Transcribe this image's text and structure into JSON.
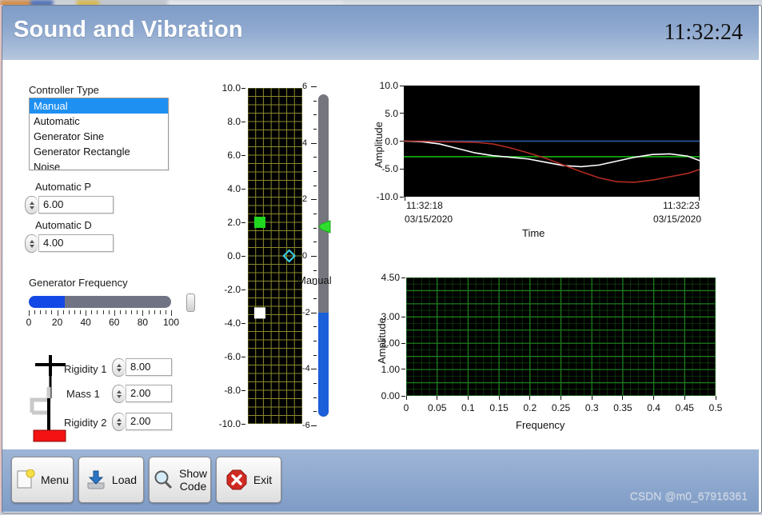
{
  "window": {
    "title": "Sound and Vibration",
    "clock": "11:32:24"
  },
  "watermark": "CSDN @m0_67916361",
  "controller": {
    "label": "Controller Type",
    "options": [
      "Manual",
      "Automatic",
      "Generator Sine",
      "Generator Rectangle",
      "Noise"
    ],
    "selected": "Manual"
  },
  "numerics": [
    {
      "label": "Automatic P",
      "value": "6.00"
    },
    {
      "label": "Automatic D",
      "value": "4.00"
    }
  ],
  "frequency": {
    "label": "Generator Frequency",
    "value": 25,
    "min": 0,
    "max": 100,
    "ticks": [
      "0",
      "20",
      "40",
      "60",
      "80",
      "100"
    ]
  },
  "mechanics": [
    {
      "label": "Rigidity 1",
      "value": "8.00"
    },
    {
      "label": "Mass 1",
      "value": "2.00"
    },
    {
      "label": "Rigidity 2",
      "value": "2.00"
    }
  ],
  "manual_slider": {
    "label": "Manual",
    "value": -2.6,
    "min": -6,
    "max": 6,
    "ticks": [
      "6",
      "4",
      "2",
      "0",
      "-2",
      "-4",
      "-6"
    ]
  },
  "colors": {
    "accent": "#1e90f2",
    "header_blue": "#8fa9cf",
    "plot_bg": "#000000",
    "grid_olive": "#8a8a2e",
    "grid_green": "#1d7d1d",
    "marker_green": "#1fd81f",
    "marker_white": "#ffffff",
    "marker_cyan": "#3fd0e8",
    "trace_red": "#b02b22",
    "trace_blue": "#2d5fa8",
    "trace_green": "#12b512",
    "trace_white": "#ffffff",
    "slider_blue": "#1448e6",
    "exit_red": "#c0392b"
  },
  "buttons": [
    {
      "label": "Menu",
      "icon": "page-icon"
    },
    {
      "label": "Load",
      "icon": "load-disk-icon"
    },
    {
      "label": "Show Code",
      "label_l1": "Show",
      "label_l2": "Code",
      "icon": "magnifier-icon"
    },
    {
      "label": "Exit",
      "icon": "stop-x-icon"
    }
  ],
  "chart_data": [
    {
      "id": "position-strip",
      "type": "scatter",
      "title": "",
      "xlabel": "",
      "ylabel": "",
      "ylim": [
        -10.0,
        10.0
      ],
      "yticks": [
        "10.0",
        "8.0",
        "6.0",
        "4.0",
        "2.0",
        "0.0",
        "-2.0",
        "-4.0",
        "-6.0",
        "-8.0",
        "-10.0"
      ],
      "grid": true,
      "grid_color": "#8a8a2e",
      "points": [
        {
          "name": "mass-marker-green",
          "x": 0.22,
          "y": 2.0,
          "color": "#1fd81f",
          "shape": "square"
        },
        {
          "name": "mass-marker-white",
          "x": 0.22,
          "y": -3.4,
          "color": "#ffffff",
          "shape": "square"
        },
        {
          "name": "target-marker-cyan",
          "x": 0.76,
          "y": 0.0,
          "color": "#3fd0e8",
          "shape": "diamond-outline"
        }
      ]
    },
    {
      "id": "time-waveform",
      "type": "line",
      "title": "",
      "xlabel": "Time",
      "ylabel": "Amplitude",
      "ylim": [
        -10.0,
        10.0
      ],
      "yticks": [
        "10.0",
        "5.0",
        "0.0",
        "-5.0",
        "-10.0"
      ],
      "xtick_start_time": "11:32:18",
      "xtick_start_date": "03/15/2020",
      "xtick_end_time": "11:32:23",
      "xtick_end_date": "03/15/2020",
      "grid": false,
      "series": [
        {
          "name": "setpoint-blue",
          "color": "#2d5fa8",
          "x": [
            0,
            1
          ],
          "values": [
            0.0,
            0.0
          ]
        },
        {
          "name": "reference-green",
          "color": "#12b512",
          "x": [
            0,
            1
          ],
          "values": [
            -2.8,
            -2.8
          ]
        },
        {
          "name": "mass1-white",
          "color": "#ffffff",
          "x": [
            0.0,
            0.06,
            0.12,
            0.18,
            0.24,
            0.3,
            0.36,
            0.42,
            0.48,
            0.54,
            0.6,
            0.66,
            0.72,
            0.78,
            0.84,
            0.9,
            0.96,
            1.0
          ],
          "values": [
            0.0,
            -0.1,
            -0.5,
            -1.3,
            -2.1,
            -2.6,
            -2.9,
            -3.2,
            -3.8,
            -4.4,
            -4.6,
            -4.3,
            -3.6,
            -2.9,
            -2.4,
            -2.3,
            -2.7,
            -3.5
          ]
        },
        {
          "name": "mass2-red",
          "color": "#b02b22",
          "x": [
            0.0,
            0.06,
            0.12,
            0.18,
            0.24,
            0.3,
            0.36,
            0.42,
            0.48,
            0.54,
            0.6,
            0.66,
            0.72,
            0.78,
            0.84,
            0.9,
            0.96,
            1.0
          ],
          "values": [
            0.0,
            0.0,
            -0.1,
            -0.15,
            -0.2,
            -0.5,
            -1.2,
            -2.1,
            -3.1,
            -4.3,
            -5.5,
            -6.6,
            -7.3,
            -7.4,
            -7.0,
            -6.4,
            -5.8,
            -5.1
          ]
        }
      ]
    },
    {
      "id": "frequency-spectrum",
      "type": "line",
      "title": "",
      "xlabel": "Frequency",
      "ylabel": "Amplitude",
      "ylim": [
        0.0,
        4.5
      ],
      "yticks": [
        "4.50",
        "3.00",
        "2.00",
        "1.00",
        "0.00"
      ],
      "xlim": [
        0,
        0.5
      ],
      "xticks": [
        "0",
        "0.05",
        "0.1",
        "0.15",
        "0.2",
        "0.25",
        "0.3",
        "0.35",
        "0.4",
        "0.45",
        "0.5"
      ],
      "grid": true,
      "grid_color": "#1d7d1d",
      "series": []
    }
  ]
}
